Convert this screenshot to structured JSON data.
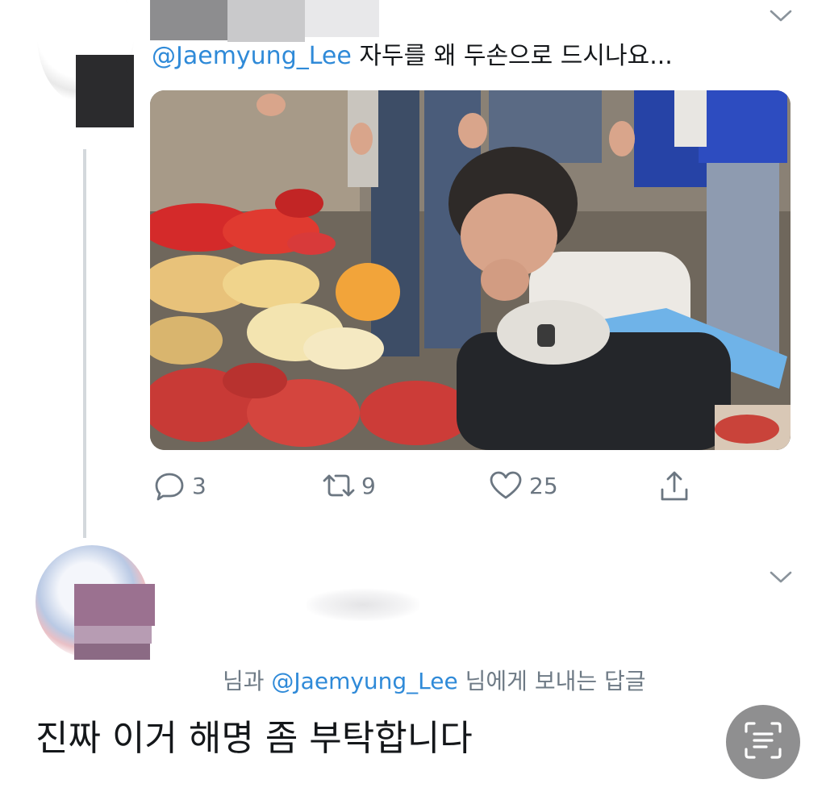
{
  "tweet": {
    "text_mention": "@Jaemyung_Lee",
    "text_body": " 자두를 왜 두손으로 드시나요...",
    "actions": {
      "reply_count": "3",
      "retweet_count": "9",
      "like_count": "25"
    },
    "icons": [
      "chevron-down-icon",
      "reply-icon",
      "retweet-icon",
      "like-icon",
      "share-icon"
    ]
  },
  "reply": {
    "reply_prefix": "님과 ",
    "reply_mention": "@Jaemyung_Lee",
    "reply_suffix": " 님에게 보내는 답글",
    "body": "진짜 이거 해명 좀 부탁합니다",
    "icons": [
      "chevron-down-icon",
      "scan-text-icon"
    ]
  },
  "colors": {
    "mention": "#2f8ad8",
    "text": "#14171a",
    "muted": "#6b7681",
    "thread_line": "#d3d8dc",
    "scan_button": "#8f8f90"
  }
}
